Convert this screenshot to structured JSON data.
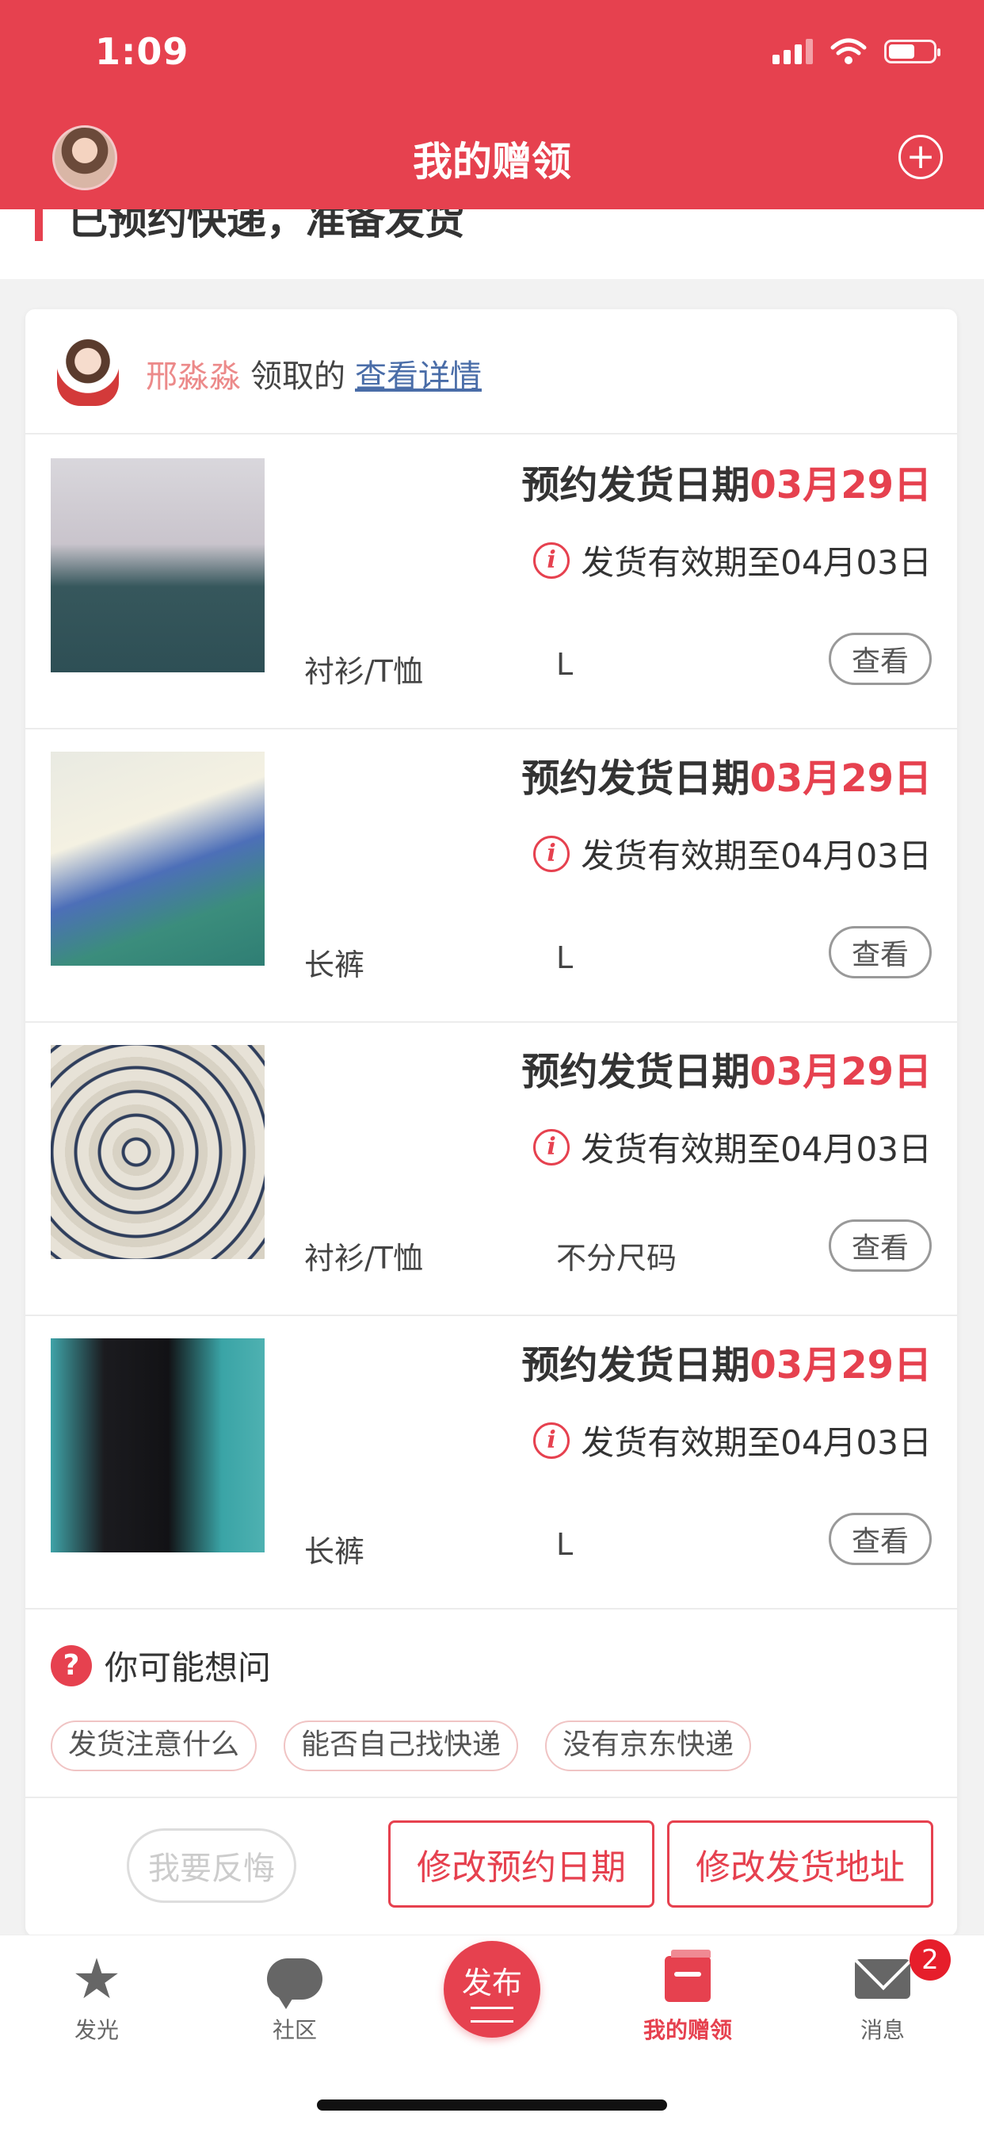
{
  "status_bar": {
    "time": "1:09"
  },
  "header": {
    "title": "我的赠领"
  },
  "section": {
    "title": "已预约快递，准备发货"
  },
  "claimer": {
    "name": "邢淼淼",
    "verb": "领取的",
    "link": "查看详情"
  },
  "items": [
    {
      "ship_prefix": "预约发货日期",
      "ship_date": "03月29日",
      "valid_text": "发货有效期至04月03日",
      "category": "衬衫/T恤",
      "size": "L",
      "view_label": "查看"
    },
    {
      "ship_prefix": "预约发货日期",
      "ship_date": "03月29日",
      "valid_text": "发货有效期至04月03日",
      "category": "长裤",
      "size": "L",
      "view_label": "查看"
    },
    {
      "ship_prefix": "预约发货日期",
      "ship_date": "03月29日",
      "valid_text": "发货有效期至04月03日",
      "category": "衬衫/T恤",
      "size": "不分尺码",
      "view_label": "查看"
    },
    {
      "ship_prefix": "预约发货日期",
      "ship_date": "03月29日",
      "valid_text": "发货有效期至04月03日",
      "category": "长裤",
      "size": "L",
      "view_label": "查看"
    }
  ],
  "faq": {
    "title": "你可能想问",
    "icon": "question-icon",
    "tags": [
      "发货注意什么",
      "能否自己找快递",
      "没有京东快递"
    ]
  },
  "actions": {
    "regret": "我要反悔",
    "modify_date": "修改预约日期",
    "modify_address": "修改发货地址"
  },
  "tabbar": {
    "tabs": [
      {
        "label": "发光",
        "icon": "star-icon"
      },
      {
        "label": "社区",
        "icon": "chat-bubble-icon"
      },
      {
        "label": "我的赠领",
        "icon": "gift-book-icon",
        "active": true
      },
      {
        "label": "消息",
        "icon": "mail-icon"
      }
    ],
    "publish_label": "发布",
    "message_badge": "2"
  },
  "colors": {
    "primary": "#e6414f",
    "link": "#4a6da8",
    "claimer_name": "#ec8a8a"
  }
}
